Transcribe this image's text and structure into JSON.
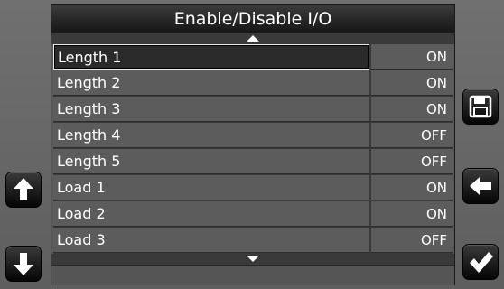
{
  "title": "Enable/Disable I/O",
  "rows": [
    {
      "name": "Length 1",
      "value": "ON"
    },
    {
      "name": "Length 2",
      "value": "ON"
    },
    {
      "name": "Length 3",
      "value": "ON"
    },
    {
      "name": "Length 4",
      "value": "OFF"
    },
    {
      "name": "Length 5",
      "value": "OFF"
    },
    {
      "name": "Load 1",
      "value": "ON"
    },
    {
      "name": "Load 2",
      "value": "ON"
    },
    {
      "name": "Load 3",
      "value": "OFF"
    }
  ],
  "selected_row": "Length 1",
  "icons": {
    "scroll_up": "arrow-up-icon",
    "scroll_down": "arrow-down-icon",
    "save": "floppy-disk-icon",
    "back": "arrow-left-icon",
    "confirm": "checkmark-icon",
    "list_up": "triangle-up-icon",
    "list_down": "triangle-down-icon"
  },
  "colors": {
    "title_bar": "#151515",
    "row_bg": "#5c5c5c",
    "selected_bg": "#2a2a2a",
    "text": "#ffffff"
  }
}
